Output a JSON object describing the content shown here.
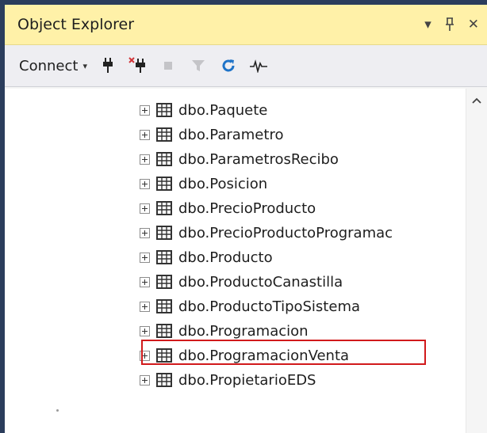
{
  "panel": {
    "title": "Object Explorer",
    "pin_glyph": "▾",
    "dock_glyph": "ᛘ",
    "close_glyph": "✕"
  },
  "toolbar": {
    "connect_label": "Connect",
    "connect_caret": "▾"
  },
  "tree": {
    "items": [
      {
        "label": "dbo.Paquete"
      },
      {
        "label": "dbo.Parametro"
      },
      {
        "label": "dbo.ParametrosRecibo"
      },
      {
        "label": "dbo.Posicion"
      },
      {
        "label": "dbo.PrecioProducto"
      },
      {
        "label": "dbo.PrecioProductoProgramac"
      },
      {
        "label": "dbo.Producto"
      },
      {
        "label": "dbo.ProductoCanastilla"
      },
      {
        "label": "dbo.ProductoTipoSistema"
      },
      {
        "label": "dbo.Programacion"
      },
      {
        "label": "dbo.ProgramacionVenta"
      },
      {
        "label": "dbo.PropietarioEDS"
      }
    ],
    "highlighted_item": "dbo.ProgramacionVenta"
  },
  "colors": {
    "titlebar_bg": "#fff1a8",
    "highlight_border": "#d1191b",
    "refresh_icon": "#1e73c8"
  }
}
